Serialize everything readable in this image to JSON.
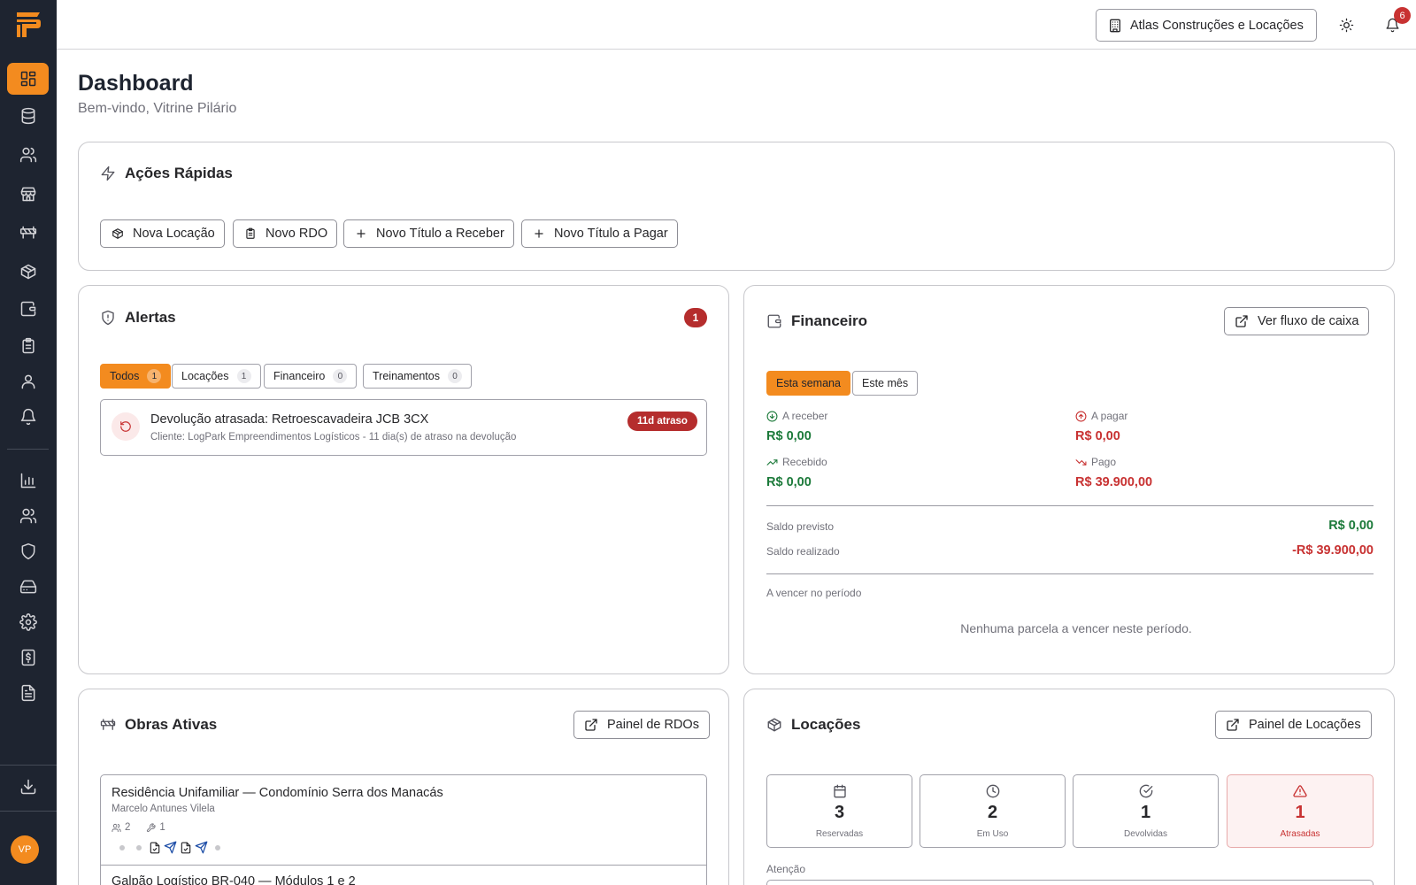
{
  "app": {
    "brand_color": "#f38b1f",
    "sidebar_color": "#1e2430",
    "logo": "logo-icon"
  },
  "sidebar": {
    "items": [
      {
        "name": "dashboard",
        "icon": "layout-grid-icon",
        "active": true
      },
      {
        "name": "database",
        "icon": "database-icon"
      },
      {
        "name": "users",
        "icon": "users-icon"
      },
      {
        "name": "store",
        "icon": "store-icon"
      },
      {
        "name": "construction",
        "icon": "barrier-icon"
      },
      {
        "name": "packages",
        "icon": "package-icon"
      },
      {
        "name": "wallet",
        "icon": "wallet-icon"
      },
      {
        "name": "clipboard",
        "icon": "clipboard-icon"
      },
      {
        "name": "user",
        "icon": "user-icon"
      },
      {
        "name": "notifications",
        "icon": "bell-icon"
      },
      {
        "name": "reports",
        "icon": "bar-chart-icon"
      },
      {
        "name": "team",
        "icon": "users-icon"
      },
      {
        "name": "security",
        "icon": "shield-icon"
      },
      {
        "name": "storage",
        "icon": "hard-drive-icon"
      },
      {
        "name": "settings",
        "icon": "gear-icon"
      },
      {
        "name": "invoices",
        "icon": "receipt-icon"
      },
      {
        "name": "documents",
        "icon": "file-text-icon"
      },
      {
        "name": "download",
        "icon": "download-icon"
      }
    ],
    "avatar_initials": "VP"
  },
  "header": {
    "company": "Atlas Construções e Locações",
    "notification_count": "6",
    "avatar_initials": "VP"
  },
  "page": {
    "title": "Dashboard",
    "subtitle": "Bem-vindo, Vitrine Pilário"
  },
  "quick_actions": {
    "title": "Ações Rápidas",
    "buttons": [
      "Nova Locação",
      "Novo RDO",
      "Novo Título a Receber",
      "Novo Título a Pagar"
    ]
  },
  "alerts": {
    "title": "Alertas",
    "count": "1",
    "filters": [
      {
        "label": "Todos",
        "count": "1",
        "active": true
      },
      {
        "label": "Locações",
        "count": "1"
      },
      {
        "label": "Financeiro",
        "count": "0"
      },
      {
        "label": "Treinamentos",
        "count": "0"
      }
    ],
    "items": [
      {
        "title": "Devolução atrasada: Retroescavadeira JCB 3CX",
        "description": "Cliente: LogPark Empreendimentos Logísticos - 11 dia(s) de atraso na devolução",
        "tag": "11d atraso"
      }
    ]
  },
  "finance": {
    "title": "Financeiro",
    "cashflow_button": "Ver fluxo de caixa",
    "tabs": [
      {
        "label": "Esta semana",
        "active": true
      },
      {
        "label": "Este mês"
      }
    ],
    "a_receber_label": "A receber",
    "a_receber_value": "R$ 0,00",
    "a_pagar_label": "A pagar",
    "a_pagar_value": "R$ 0,00",
    "recebido_label": "Recebido",
    "recebido_value": "R$ 0,00",
    "pago_label": "Pago",
    "pago_value": "R$ 39.900,00",
    "saldo_previsto_label": "Saldo previsto",
    "saldo_previsto_value": "R$ 0,00",
    "saldo_realizado_label": "Saldo realizado",
    "saldo_realizado_value": "-R$ 39.900,00",
    "vencer_label": "A vencer no período",
    "empty_message": "Nenhuma parcela a vencer neste período.",
    "positive_color": "#1c7a3a",
    "negative_color": "#c83232"
  },
  "obras": {
    "title": "Obras Ativas",
    "panel_button": "Painel de RDOs",
    "items": [
      {
        "title": "Residência Unifamiliar — Condomínio Serra dos Manacás",
        "responsible": "Marcelo Antunes Vilela",
        "workers": "2",
        "equipment": "1"
      },
      {
        "title": "Galpão Logístico BR-040 — Módulos 1 e 2"
      }
    ]
  },
  "locacoes": {
    "title": "Locações",
    "panel_button": "Painel de Locações",
    "stats": [
      {
        "value": "3",
        "label": "Reservadas",
        "icon": "calendar-icon"
      },
      {
        "value": "2",
        "label": "Em Uso",
        "icon": "clock-icon"
      },
      {
        "value": "1",
        "label": "Devolvidas",
        "icon": "check-circle-icon"
      },
      {
        "value": "1",
        "label": "Atrasadas",
        "icon": "alert-triangle-icon"
      }
    ],
    "attention_label": "Atenção"
  }
}
